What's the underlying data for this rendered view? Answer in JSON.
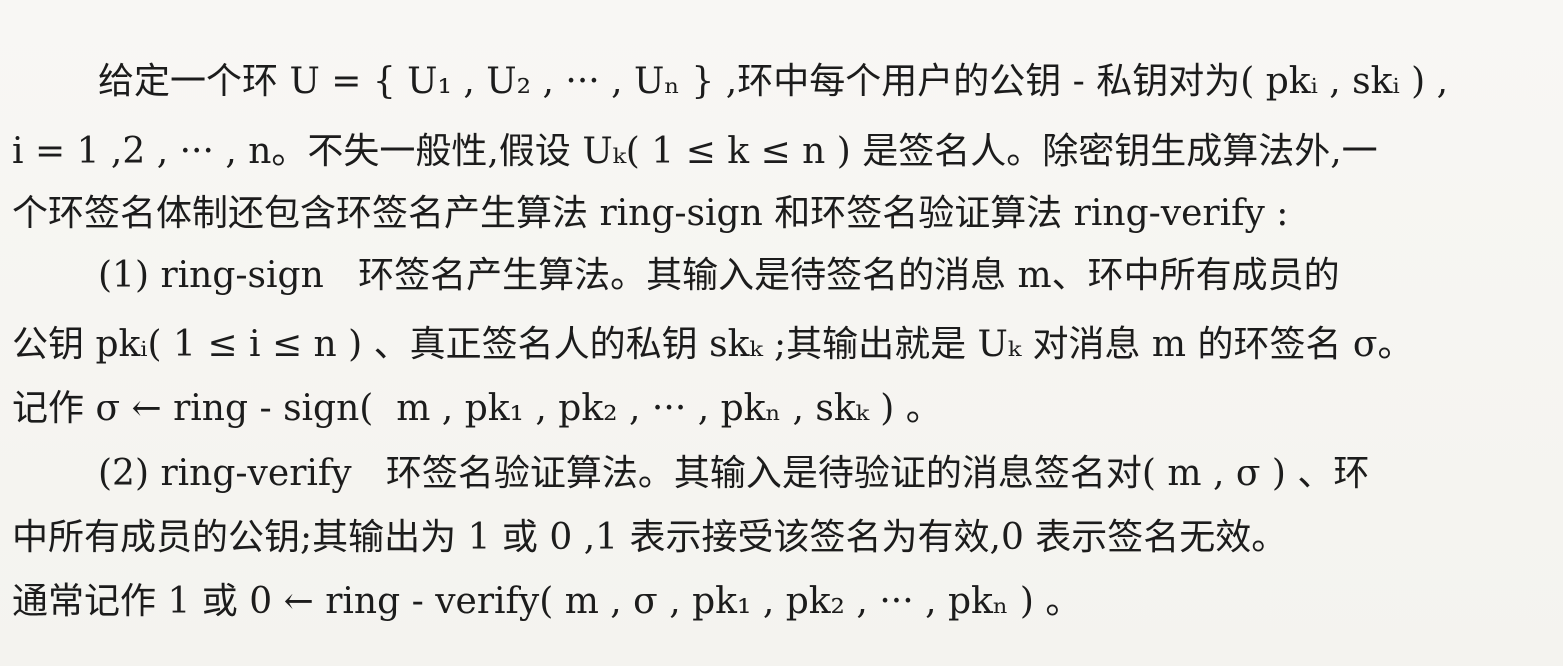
{
  "document": {
    "lines": [
      "给定一个环 U = { U₁ , U₂ , ··· , Uₙ } ,环中每个用户的公钥 - 私钥对为( pkᵢ , skᵢ ) ,",
      "i = 1 ,2 , ··· , n。不失一般性,假设 Uₖ( 1 ≤ k ≤ n ) 是签名人。除密钥生成算法外,一",
      "个环签名体制还包含环签名产生算法 ring-sign 和环签名验证算法 ring-verify :",
      "(1) ring-sign   环签名产生算法。其输入是待签名的消息 m、环中所有成员的",
      "公钥 pkᵢ( 1 ≤ i ≤ n ) 、真正签名人的私钥 skₖ ;其输出就是 Uₖ 对消息 m 的环签名 σ。",
      "记作 σ ← ring - sign(  m , pk₁ , pk₂ , ··· , pkₙ , skₖ ) 。",
      "(2) ring-verify   环签名验证算法。其输入是待验证的消息签名对( m , σ ) 、环",
      "中所有成员的公钥;其输出为 1 或 0 ,1 表示接受该签名为有效,0 表示签名无效。",
      "通常记作 1 或 0 ← ring - verify( m , σ , pk₁ , pk₂ , ··· , pkₙ ) 。"
    ]
  }
}
